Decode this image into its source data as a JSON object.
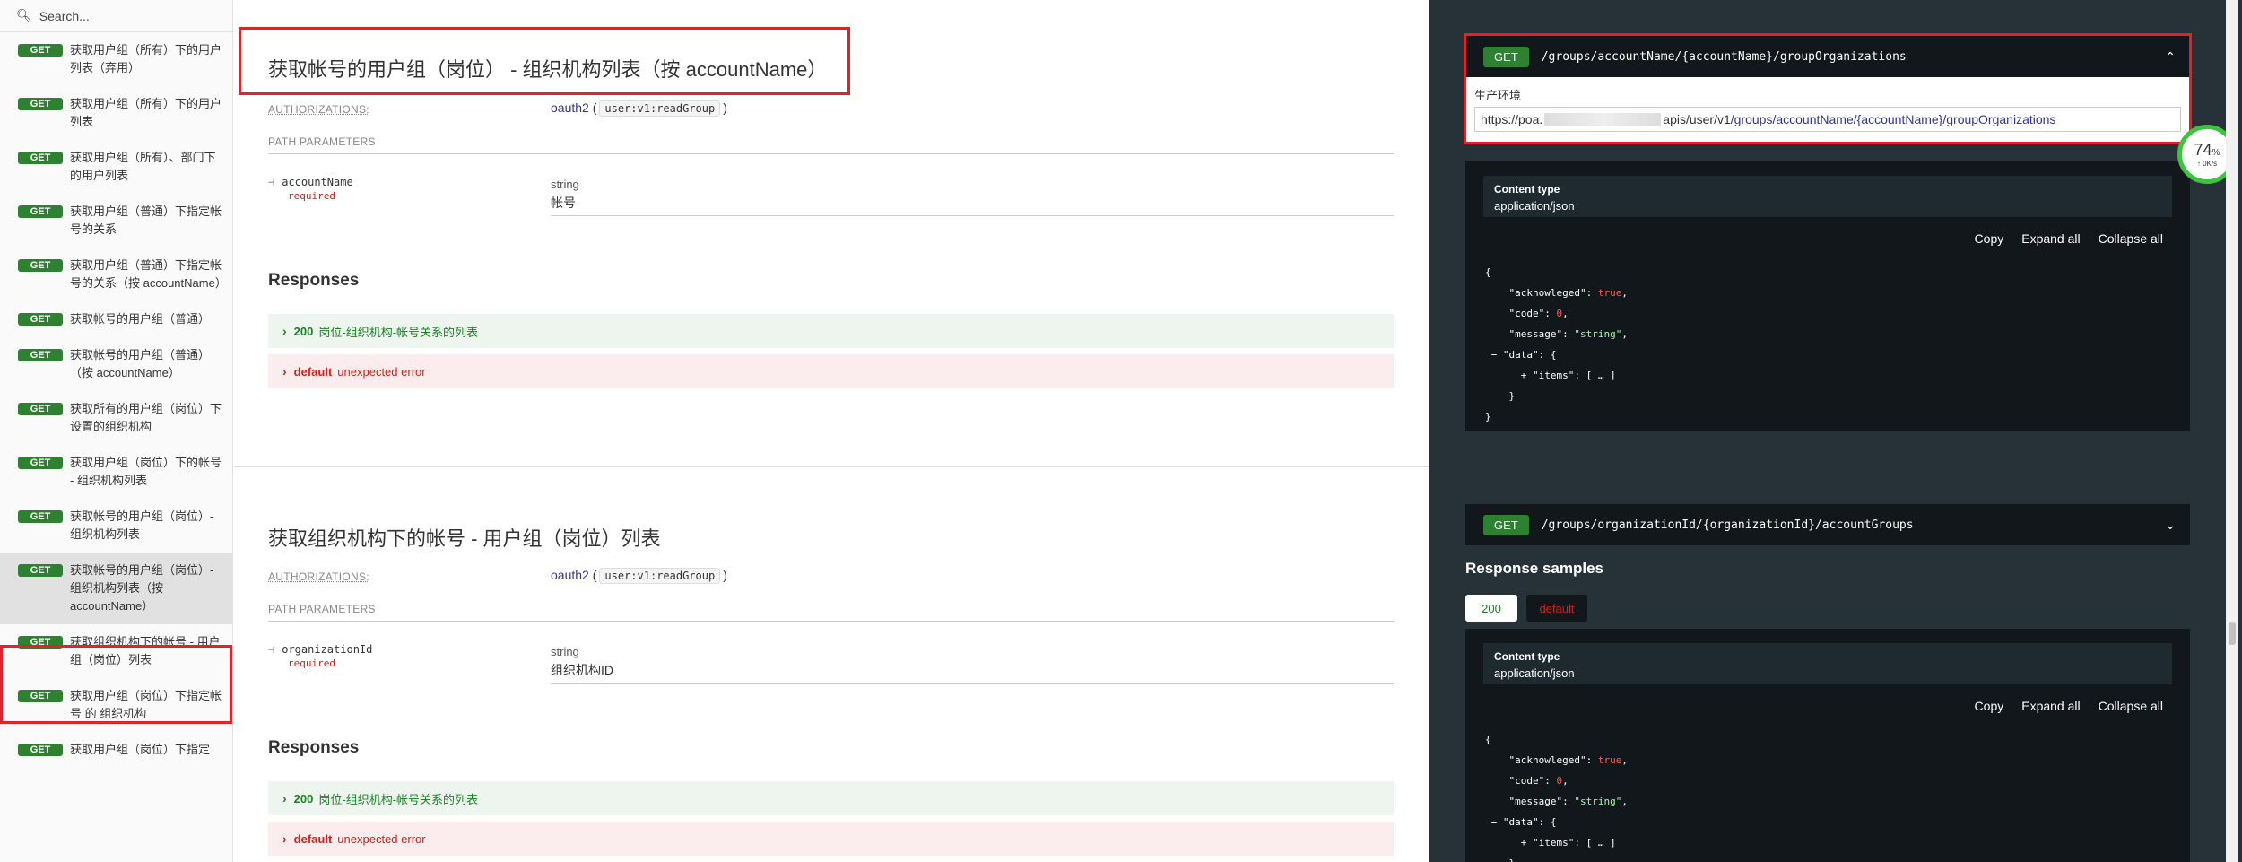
{
  "sidebar": {
    "search_placeholder": "Search...",
    "items": [
      {
        "method": "GET",
        "label": "获取用户组（所有）下的用户列表（弃用）"
      },
      {
        "method": "GET",
        "label": "获取用户组（所有）下的用户列表"
      },
      {
        "method": "GET",
        "label": "获取用户组（所有）、部门下的用户列表"
      },
      {
        "method": "GET",
        "label": "获取用户组（普通）下指定帐号的关系"
      },
      {
        "method": "GET",
        "label": "获取用户组（普通）下指定帐号的关系（按 accountName）"
      },
      {
        "method": "GET",
        "label": "获取帐号的用户组（普通）"
      },
      {
        "method": "GET",
        "label": "获取帐号的用户组（普通）（按 accountName）"
      },
      {
        "method": "GET",
        "label": "获取所有的用户组（岗位）下设置的组织机构"
      },
      {
        "method": "GET",
        "label": "获取用户组（岗位）下的帐号 - 组织机构列表"
      },
      {
        "method": "GET",
        "label": "获取帐号的用户组（岗位）- 组织机构列表"
      },
      {
        "method": "GET",
        "label": "获取帐号的用户组（岗位）- 组织机构列表（按 accountName）"
      },
      {
        "method": "GET",
        "label": "获取组织机构下的帐号 - 用户组（岗位）列表"
      },
      {
        "method": "GET",
        "label": "获取用户组（岗位）下指定帐号 的 组织机构"
      },
      {
        "method": "GET",
        "label": "获取用户组（岗位）下指定"
      }
    ]
  },
  "ops": [
    {
      "title": "获取帐号的用户组（岗位） - 组织机构列表（按 accountName）",
      "auth_label": "AUTHORIZATIONS:",
      "auth_scheme": "oauth2",
      "auth_scope": "user:v1:readGroup",
      "path_params_label": "PATH PARAMETERS",
      "param_name": "accountName",
      "param_required": "required",
      "param_type": "string",
      "param_desc": "帐号",
      "responses_label": "Responses",
      "resp_ok_code": "200",
      "resp_ok_desc": "岗位-组织机构-帐号关系的列表",
      "resp_err_code": "default",
      "resp_err_desc": "unexpected error"
    },
    {
      "title": "获取组织机构下的帐号 - 用户组（岗位）列表",
      "auth_label": "AUTHORIZATIONS:",
      "auth_scheme": "oauth2",
      "auth_scope": "user:v1:readGroup",
      "path_params_label": "PATH PARAMETERS",
      "param_name": "organizationId",
      "param_required": "required",
      "param_type": "string",
      "param_desc": "组织机构ID",
      "responses_label": "Responses",
      "resp_ok_code": "200",
      "resp_ok_desc": "岗位-组织机构-帐号关系的列表",
      "resp_err_code": "default",
      "resp_err_desc": "unexpected error"
    }
  ],
  "right": {
    "endpoints": [
      {
        "method": "GET",
        "path": "/groups/accountName/{accountName}/groupOrganizations",
        "chevron": "⌃"
      },
      {
        "method": "GET",
        "path": "/groups/organizationId/{organizationId}/accountGroups",
        "chevron": "⌄"
      }
    ],
    "server_env": "生产环境",
    "server_url_a": "https://poa.",
    "server_url_mid": "apis/user/v1",
    "server_url_b": "/groups/accountName/{accountName}/groupOrganizations",
    "samples_title": "Response samples",
    "tab_200": "200",
    "tab_default": "default",
    "content_type_label": "Content type",
    "content_type_value": "application/json",
    "actions": {
      "copy": "Copy",
      "expand": "Expand all",
      "collapse": "Collapse all"
    }
  },
  "widget": {
    "pct": "74",
    "pct_unit": "%",
    "rate": "↑ 0K/s"
  },
  "colors": {
    "get_green": "#2f8132",
    "highlight_red": "#e0232b",
    "panel_dark": "#263238",
    "code_dark": "#11171a"
  }
}
